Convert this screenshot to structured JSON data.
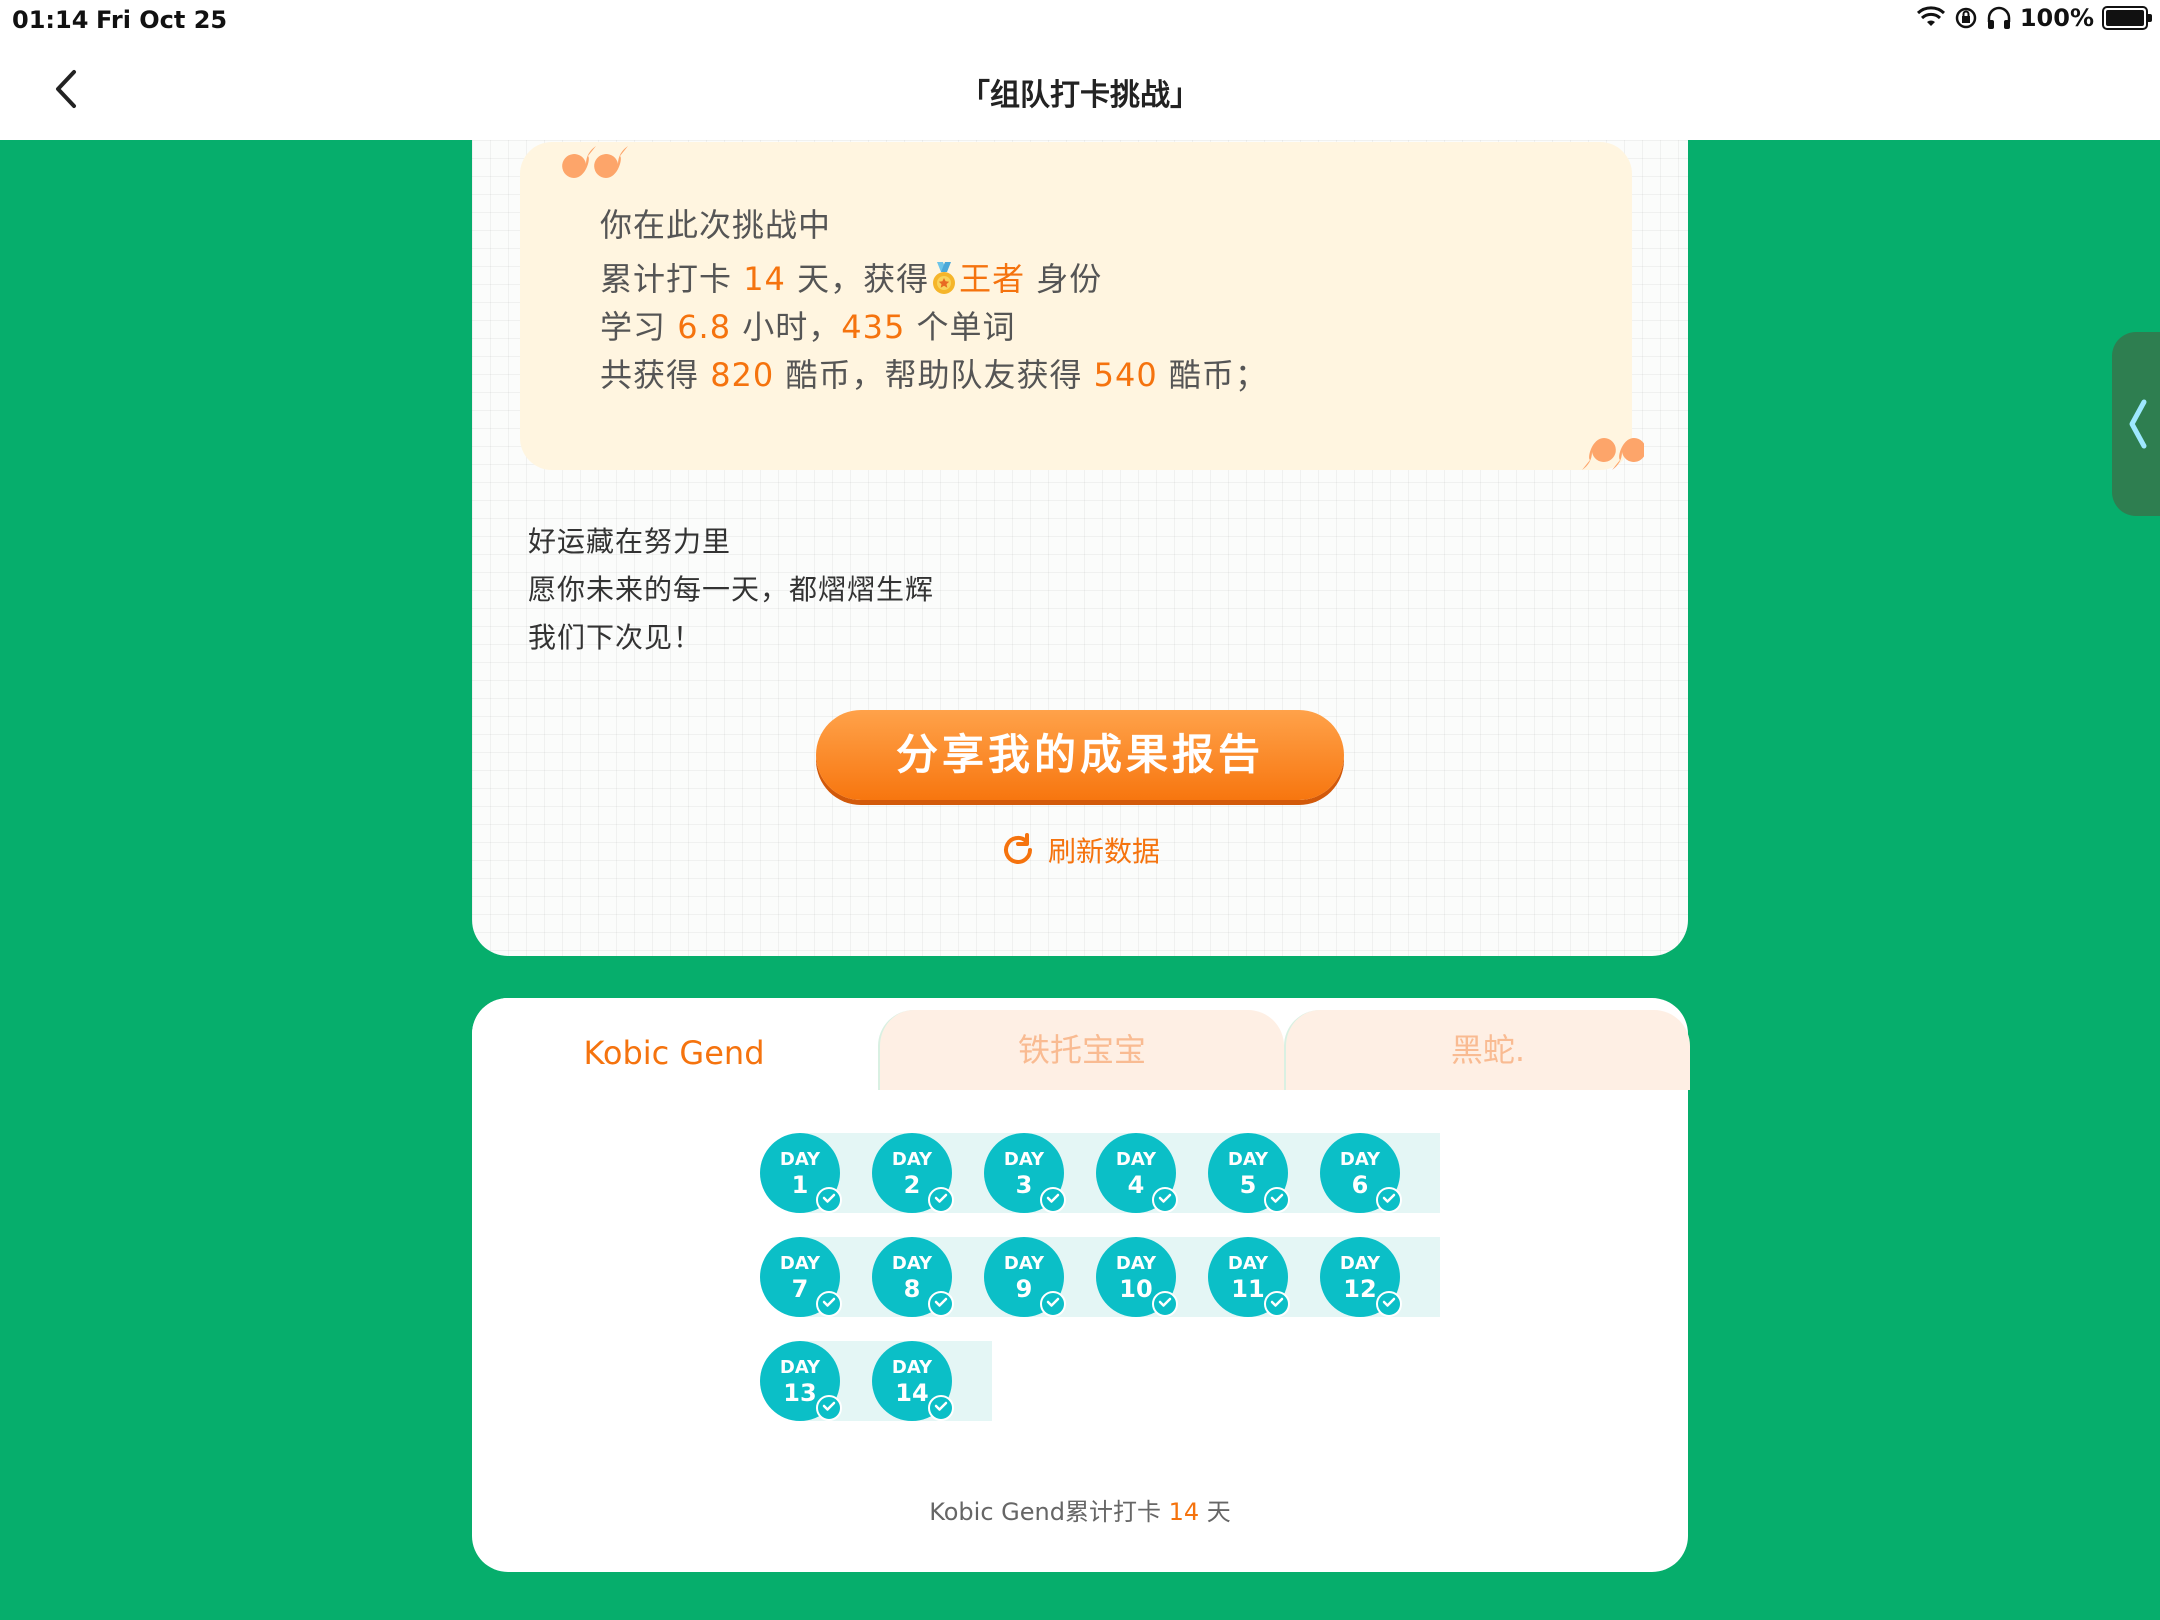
{
  "status_bar": {
    "time": "01:14",
    "date": "Fri Oct 25",
    "battery": "100%"
  },
  "nav": {
    "title": "「组队打卡挑战」"
  },
  "quote": {
    "line1": "你在此次挑战中",
    "line2_a": "累计打卡 ",
    "line2_days": "14",
    "line2_b": " 天，获得",
    "line2_rank": "王者",
    "line2_c": " 身份",
    "line3_a": "学习 ",
    "line3_hours": "6.8",
    "line3_b": " 小时，",
    "line3_words": "435",
    "line3_c": " 个单词",
    "line4_a": "共获得 ",
    "line4_coins": "820",
    "line4_b": " 酷币，帮助队友获得 ",
    "line4_help": "540",
    "line4_c": " 酷币；"
  },
  "blessing": {
    "line1": "好运藏在努力里",
    "line2": "愿你未来的每一天，都熠熠生辉",
    "line3": "我们下次见！"
  },
  "share_button": "分享我的成果报告",
  "refresh_label": "刷新数据",
  "tabs": [
    {
      "label": "Kobic Gend",
      "active": true
    },
    {
      "label": "铁托宝宝",
      "active": false
    },
    {
      "label": "黑蛇.",
      "active": false
    }
  ],
  "day_prefix": "DAY",
  "days": [
    "1",
    "2",
    "3",
    "4",
    "5",
    "6",
    "7",
    "8",
    "9",
    "10",
    "11",
    "12",
    "13",
    "14"
  ],
  "summary": {
    "prefix": "Kobic Gend累计打卡 ",
    "count": "14",
    "suffix": " 天"
  },
  "colors": {
    "background": "#06AE6C",
    "accent": "#F5730E",
    "day_circle": "#0BBFC7"
  }
}
